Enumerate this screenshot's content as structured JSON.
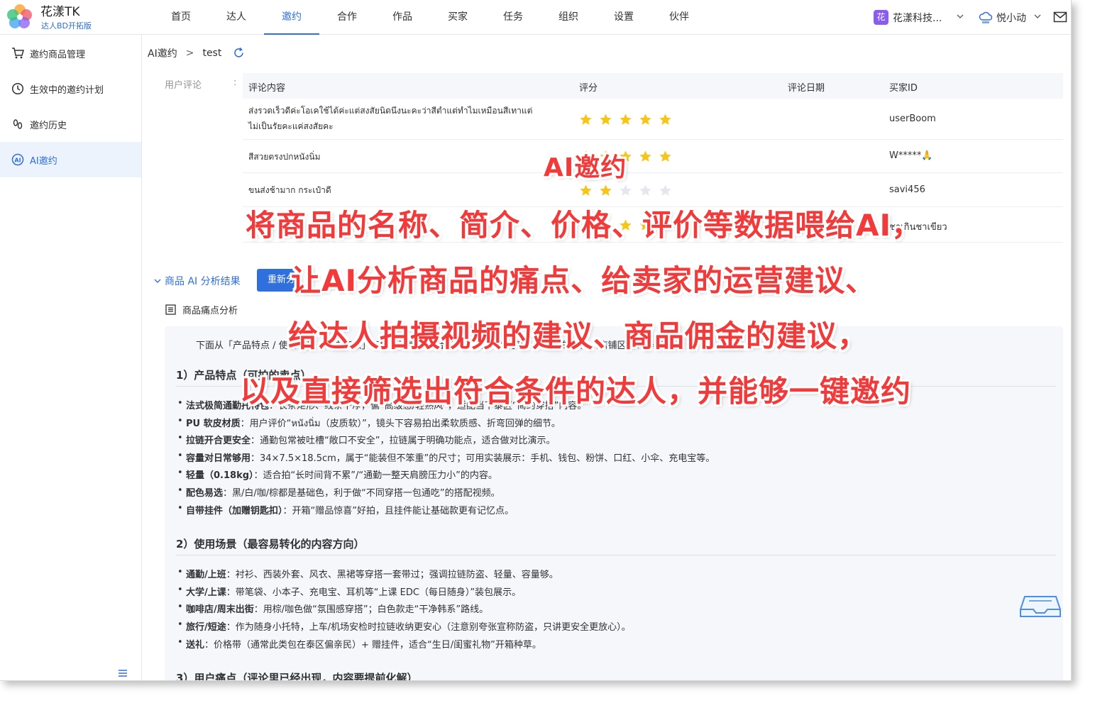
{
  "app": {
    "name": "花漾TK",
    "subtitle": "达人BD开拓版"
  },
  "nav": {
    "items": [
      "首页",
      "达人",
      "邀约",
      "合作",
      "作品",
      "买家",
      "任务",
      "组织",
      "设置",
      "伙伴"
    ],
    "active_index": 2
  },
  "header_right": {
    "org_badge": "花",
    "org_name": "花漾科技...",
    "user_name": "悦小动"
  },
  "sidebar": {
    "items": [
      {
        "label": "邀约商品管理",
        "icon": "cart-icon"
      },
      {
        "label": "生效中的邀约计划",
        "icon": "clock-icon"
      },
      {
        "label": "邀约历史",
        "icon": "footprint-icon"
      },
      {
        "label": "AI邀约",
        "icon": "ai-icon"
      }
    ],
    "active_index": 3
  },
  "breadcrumb": {
    "root": "AI邀约",
    "current": "test"
  },
  "reviews": {
    "field_label": "用户评论",
    "field_colon": ":",
    "columns": [
      "评论内容",
      "评分",
      "评论日期",
      "买家ID"
    ],
    "rows": [
      {
        "content_line1": "ส่งรวดเร็วดีค่ะโอเคใช้ได้ค่ะแต่สงสัยนิดนึงนะคะว่าสีตำแต่ทำไมเหมือนสีเทาแต่",
        "content_line2": "ไม่เป็นรัยคะแค่สงสัยคะ",
        "rating": 5,
        "buyer": "userBoom"
      },
      {
        "content_line1": "สีสวยตรงปกหนังนิ่ม",
        "content_line2": "",
        "rating": 5,
        "buyer": "W*****🙏"
      },
      {
        "content_line1": "ขนส่งช้ามาก กระเป๋าดี",
        "content_line2": "",
        "rating": 2,
        "buyer": "savi456"
      },
      {
        "content_line1": "",
        "content_line2": "",
        "rating": 5,
        "buyer": "ชาเกินชาเขียว"
      }
    ],
    "star_colors": {
      "filled": "#f5c518",
      "empty": "#e4e7ed"
    }
  },
  "ai_section": {
    "toggle_label": "商品 AI 分析结果",
    "regen_button": "重新分析",
    "pain_title": "商品痛点分析",
    "intro": "下面从「产品特点 / 使用场景 / 用户痛点」三块，提炼更适合 TikTok 达人拍内容、促转化的要点（店铺区域：泰国）。",
    "sections": [
      {
        "heading": "1）产品特点（可拍的卖点）",
        "items": [
          {
            "bold": "法式极简通勤托特包",
            "text": "：长条矩形、线条干净，偏“高级感/轻熟风”，适配当下泰区“简约穿搭”内容。"
          },
          {
            "bold": "PU 软皮材质",
            "text": "：用户评价“หนังนิ่ม（皮质软）”，镜头下容易拍出柔软质感、折弯回弹的细节。"
          },
          {
            "bold": "拉链开合更安全",
            "text": "：通勤包常被吐槽“敞口不安全”，拉链属于明确功能点，适合做对比演示。"
          },
          {
            "bold": "容量对日常够用",
            "text": "：34×7.5×18.5cm，属于“能装但不笨重”的尺寸；可用实装展示：手机、钱包、粉饼、口红、小伞、充电宝等。"
          },
          {
            "bold": "轻量（0.18kg）",
            "text": "：适合拍“长时间背不累”/“通勤一整天肩膀压力小”的内容。"
          },
          {
            "bold": "配色易选",
            "text": "：黑/白/咖/棕都是基础色，利于做“不同穿搭一包通吃”的搭配视频。"
          },
          {
            "bold": "自带挂件（加赠钥匙扣）",
            "text": "：开箱“赠品惊喜”好拍，且挂件能让基础款更有记忆点。"
          }
        ]
      },
      {
        "heading": "2）使用场景（最容易转化的内容方向）",
        "items": [
          {
            "bold": "通勤/上班",
            "text": "：衬衫、西装外套、风衣、黑裙等穿搭一套带过；强调拉链防盗、轻量、容量够。"
          },
          {
            "bold": "大学/上课",
            "text": "：带笔袋、小本子、充电宝、耳机等“上课 EDC（每日随身）”装包展示。"
          },
          {
            "bold": "咖啡店/周末出街",
            "text": "：用棕/咖色做“氛围感穿搭”；白色款走“干净韩系”路线。"
          },
          {
            "bold": "旅行/短途",
            "text": "：作为随身小托特，上车/机场安检时拉链收纳更安心（注意别夸张宣称防盗，只讲更安全更放心）。"
          },
          {
            "bold": "送礼",
            "text": "：价格带（通常此类包在泰区偏亲民）+ 赠挂件，适合“生日/闺蜜礼物”开箱种草。"
          }
        ]
      },
      {
        "heading": "3）用户痛点（评论里已经出现，内容要提前化解）",
        "items": []
      }
    ]
  },
  "overlay": {
    "title": "AI邀约",
    "lines": [
      "将商品的名称、简介、价格、评价等数据喂给AI，",
      "让AI分析商品的痛点、给卖家的运营建议、",
      "给达人拍摄视频的建议、商品佣金的建议，",
      "以及直接筛选出符合条件的达人，并能够一键邀约"
    ]
  }
}
